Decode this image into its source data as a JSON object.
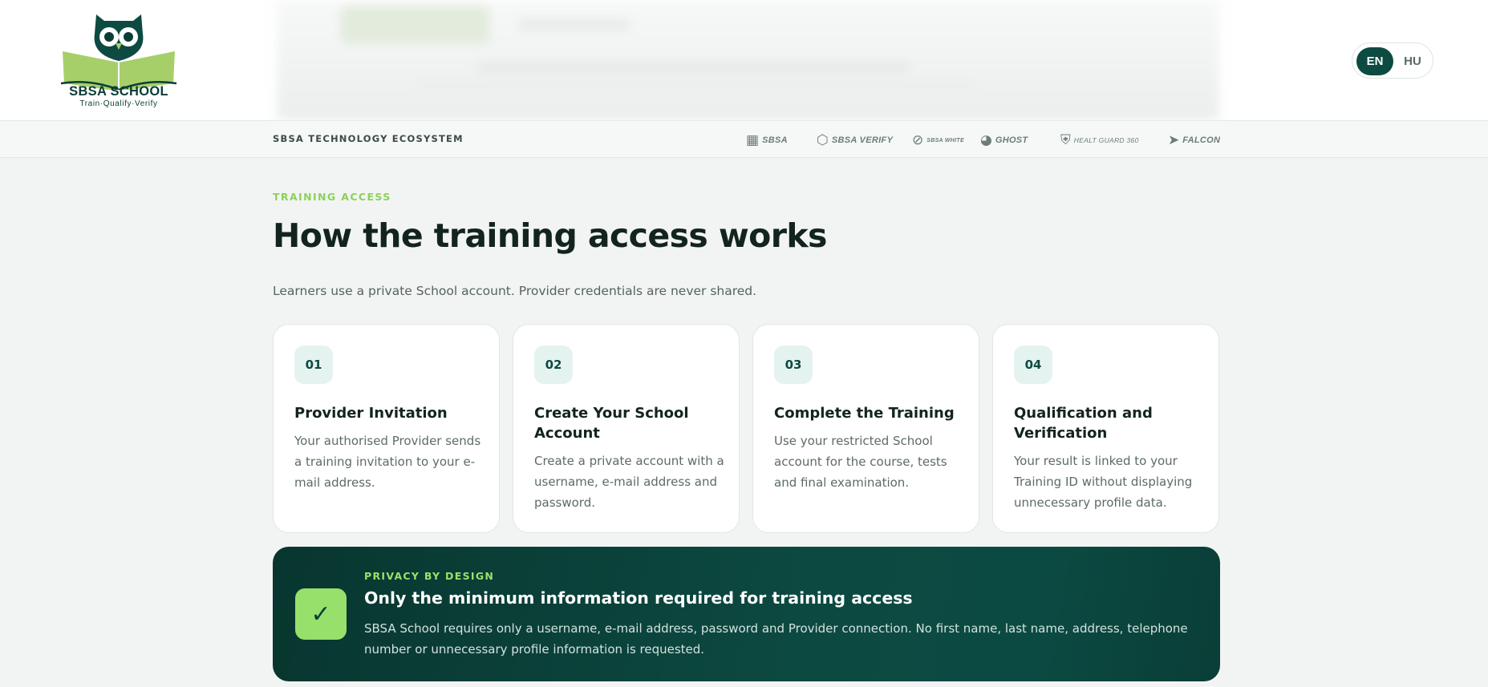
{
  "logo": {
    "title": "SBSA SCHOOL",
    "tagline": "Train·Qualify·Verify"
  },
  "language": {
    "options": [
      "EN",
      "HU"
    ],
    "active": "EN"
  },
  "ecosystem": {
    "label": "SBSA TECHNOLOGY ECOSYSTEM",
    "logos": [
      {
        "name": "SBSA",
        "icon": "sbsa-mark-icon"
      },
      {
        "name": "SBSA VERIFY",
        "icon": "hexagon-icon"
      },
      {
        "name": "SBSA WHITE",
        "icon": "circle-slash-icon"
      },
      {
        "name": "GHOST",
        "icon": "ghost-g-icon"
      },
      {
        "name": "HEALT GUARD 360",
        "icon": "shield-icon"
      },
      {
        "name": "FALCON",
        "icon": "falcon-icon"
      }
    ]
  },
  "section": {
    "eyebrow": "TRAINING ACCESS",
    "title": "How the training access works",
    "subtitle": "Learners use a private School account. Provider credentials are never shared."
  },
  "steps": [
    {
      "num": "01",
      "title": "Provider Invitation",
      "text": "Your authorised Provider sends a training invitation to your e-mail address."
    },
    {
      "num": "02",
      "title": "Create Your School Account",
      "text": "Create a private account with a username, e-mail address and password."
    },
    {
      "num": "03",
      "title": "Complete the Training",
      "text": "Use your restricted School account for the course, tests and final examination."
    },
    {
      "num": "04",
      "title": "Qualification and Verification",
      "text": "Your result is linked to your Training ID without displaying unnecessary profile data."
    }
  ],
  "privacy": {
    "icon": "checkmark-icon",
    "eyebrow": "PRIVACY BY DESIGN",
    "title": "Only the minimum information required for training access",
    "text": "SBSA School requires only a username, e-mail address, password and Provider connection. No first name, last name, address, telephone number or unnecessary profile information is requested."
  },
  "colors": {
    "brand_dark": "#0d4a42",
    "accent_green": "#97e06c",
    "eyebrow_green": "#8bd15a"
  }
}
